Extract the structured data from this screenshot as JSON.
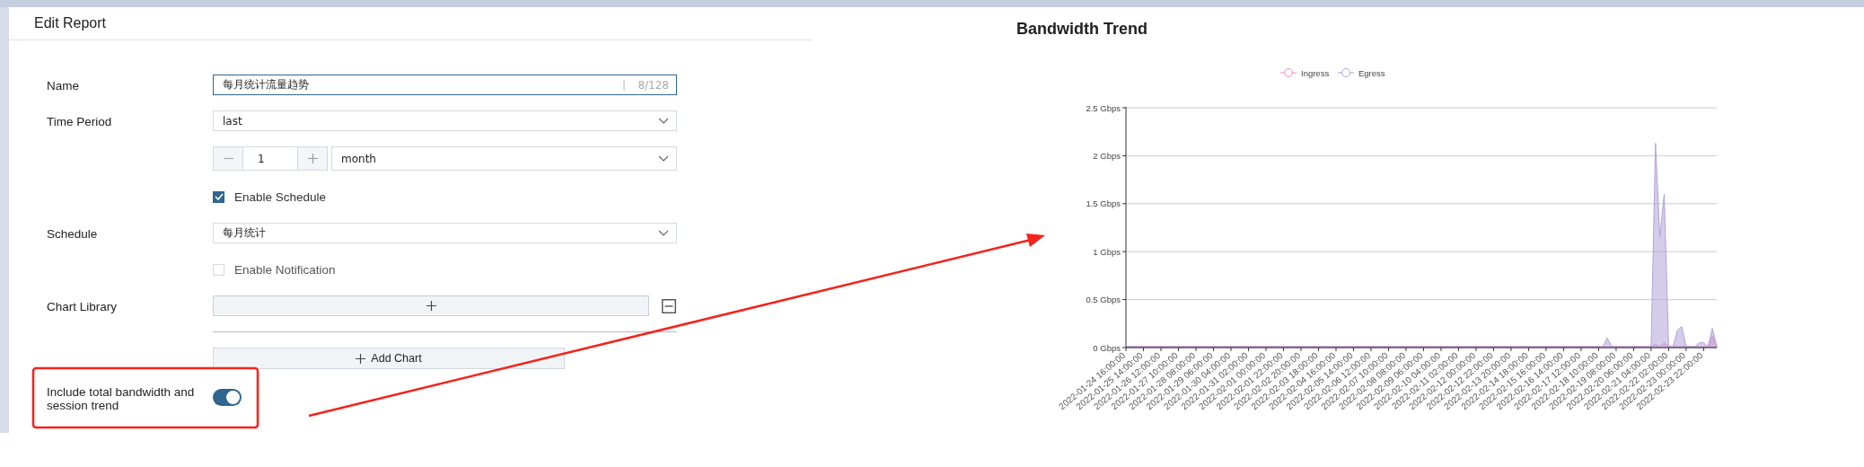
{
  "panel": {
    "title": "Edit Report"
  },
  "form": {
    "name": {
      "label": "Name",
      "value": "每月统计流量趋势",
      "counter": "8/128"
    },
    "time_period": {
      "label": "Time Period",
      "value": "last"
    },
    "period_count": {
      "value": "1",
      "unit": "month"
    },
    "enable_schedule": {
      "label": "Enable Schedule",
      "checked": true
    },
    "schedule": {
      "label": "Schedule",
      "value": "每月统计"
    },
    "enable_notification": {
      "label": "Enable Notification",
      "checked": false
    },
    "chart_library": {
      "label": "Chart Library"
    },
    "add_chart": {
      "label": "Add Chart"
    },
    "include_trend": {
      "label": "Include total bandwidth and session trend",
      "on": true
    }
  },
  "chart": {
    "title": "Bandwidth Trend",
    "chart_data": {
      "type": "area",
      "categories": [
        "2022-01-24 16:00:00",
        null,
        null,
        null,
        "2022-01-25 14:00:00",
        null,
        null,
        null,
        "2022-01-26 12:00:00",
        null,
        null,
        null,
        "2022-01-27 10:00:00",
        null,
        null,
        null,
        "2022-01-28 08:00:00",
        null,
        null,
        null,
        "2022-01-29 06:00:00",
        null,
        null,
        null,
        "2022-01-30 04:00:00",
        null,
        null,
        null,
        "2022-01-31 02:00:00",
        null,
        null,
        null,
        "2022-02-01 00:00:00",
        null,
        null,
        null,
        "2022-02-01 22:00:00",
        null,
        null,
        null,
        "2022-02-02 20:00:00",
        null,
        null,
        null,
        "2022-02-03 18:00:00",
        null,
        null,
        null,
        "2022-02-04 16:00:00",
        null,
        null,
        null,
        "2022-02-05 14:00:00",
        null,
        null,
        null,
        "2022-02-06 12:00:00",
        null,
        null,
        null,
        "2022-02-07 10:00:00",
        null,
        null,
        null,
        "2022-02-08 08:00:00",
        null,
        null,
        null,
        "2022-02-09 06:00:00",
        null,
        null,
        null,
        "2022-02-10 04:00:00",
        null,
        null,
        null,
        "2022-02-11 02:00:00",
        null,
        null,
        null,
        "2022-02-12 00:00:00",
        null,
        null,
        null,
        "2022-02-12 22:00:00",
        null,
        null,
        null,
        "2022-02-13 20:00:00",
        null,
        null,
        null,
        "2022-02-14 18:00:00",
        null,
        null,
        null,
        "2022-02-15 16:00:00",
        null,
        null,
        null,
        "2022-02-16 14:00:00",
        null,
        null,
        null,
        "2022-02-17 12:00:00",
        null,
        null,
        null,
        "2022-02-18 10:00:00",
        null,
        null,
        null,
        "2022-02-19 08:00:00",
        null,
        null,
        null,
        "2022-02-20 06:00:00",
        null,
        null,
        null,
        "2022-02-21 04:00:00",
        null,
        null,
        null,
        "2022-02-22 02:00:00",
        null,
        null,
        null,
        "2022-02-23 00:00:00",
        null,
        null,
        null,
        "2022-02-23 22:00:00",
        null,
        null,
        null
      ],
      "series": [
        {
          "name": "Ingress",
          "color": "#e58fc9",
          "values": [
            0.01,
            0.01,
            0.01,
            0.01,
            0.01,
            0.01,
            0.01,
            0.01,
            0.01,
            0.01,
            0.01,
            0.01,
            0.01,
            0.01,
            0.01,
            0.01,
            0.01,
            0.01,
            0.01,
            0.01,
            0.01,
            0.01,
            0.01,
            0.01,
            0.01,
            0.01,
            0.01,
            0.01,
            0.01,
            0.01,
            0.01,
            0.01,
            0.01,
            0.01,
            0.01,
            0.01,
            0.01,
            0.01,
            0.01,
            0.01,
            0.01,
            0.01,
            0.01,
            0.01,
            0.01,
            0.01,
            0.01,
            0.01,
            0.01,
            0.01,
            0.01,
            0.01,
            0.01,
            0.01,
            0.01,
            0.01,
            0.01,
            0.01,
            0.01,
            0.01,
            0.01,
            0.01,
            0.01,
            0.01,
            0.01,
            0.01,
            0.01,
            0.01,
            0.01,
            0.01,
            0.01,
            0.01,
            0.01,
            0.01,
            0.01,
            0.01,
            0.01,
            0.01,
            0.01,
            0.01,
            0.01,
            0.01,
            0.01,
            0.01,
            0.01,
            0.01,
            0.01,
            0.01,
            0.01,
            0.01,
            0.01,
            0.01,
            0.01,
            0.01,
            0.01,
            0.01,
            0.01,
            0.01,
            0.01,
            0.01,
            0.01,
            0.01,
            0.01,
            0.01,
            0.01,
            0.01,
            0.01,
            0.01,
            0.01,
            0.01,
            0.01,
            0.01,
            0.01,
            0.01,
            0.01,
            0.01,
            0.01,
            0.01,
            0.01,
            0.01,
            0.01,
            0.03,
            0.01,
            0.05,
            0.01,
            0.01,
            0.01,
            0.01,
            0.01,
            0.01,
            0.01,
            0.01,
            0.01,
            0.01,
            0.12,
            0.01
          ]
        },
        {
          "name": "Egress",
          "color": "#b3a3d9",
          "values": [
            0.01,
            0.01,
            0.01,
            0.01,
            0.01,
            0.01,
            0.01,
            0.01,
            0.01,
            0.01,
            0.01,
            0.01,
            0.01,
            0.01,
            0.01,
            0.01,
            0.01,
            0.01,
            0.01,
            0.01,
            0.01,
            0.01,
            0.01,
            0.01,
            0.01,
            0.01,
            0.01,
            0.01,
            0.01,
            0.01,
            0.01,
            0.01,
            0.01,
            0.01,
            0.01,
            0.01,
            0.01,
            0.01,
            0.01,
            0.01,
            0.01,
            0.01,
            0.01,
            0.01,
            0.01,
            0.01,
            0.01,
            0.01,
            0.01,
            0.01,
            0.01,
            0.01,
            0.01,
            0.01,
            0.01,
            0.01,
            0.01,
            0.01,
            0.01,
            0.01,
            0.01,
            0.01,
            0.01,
            0.01,
            0.01,
            0.01,
            0.01,
            0.01,
            0.01,
            0.01,
            0.01,
            0.01,
            0.01,
            0.01,
            0.01,
            0.01,
            0.01,
            0.01,
            0.01,
            0.01,
            0.01,
            0.01,
            0.01,
            0.01,
            0.01,
            0.01,
            0.01,
            0.01,
            0.01,
            0.01,
            0.01,
            0.01,
            0.01,
            0.01,
            0.01,
            0.01,
            0.01,
            0.01,
            0.01,
            0.01,
            0.01,
            0.01,
            0.01,
            0.01,
            0.01,
            0.01,
            0.01,
            0.01,
            0.01,
            0.01,
            0.1,
            0.01,
            0.01,
            0.01,
            0.01,
            0.01,
            0.01,
            0.01,
            0.01,
            0.01,
            0.01,
            2.13,
            1.15,
            1.6,
            0.01,
            0.01,
            0.18,
            0.22,
            0.01,
            0.01,
            0.01,
            0.05,
            0.05,
            0.01,
            0.2,
            0.01
          ]
        }
      ],
      "ylim": [
        0,
        2.5
      ],
      "grid": true,
      "legend": true,
      "yticks": [
        {
          "value": 0,
          "label": "0 Gbps"
        },
        {
          "value": 0.5,
          "label": "0.5 Gbps"
        },
        {
          "value": 1,
          "label": "1 Gbps"
        },
        {
          "value": 1.5,
          "label": "1.5 Gbps"
        },
        {
          "value": 2,
          "label": "2 Gbps"
        },
        {
          "value": 2.5,
          "label": "2.5 Gbps"
        }
      ]
    }
  }
}
